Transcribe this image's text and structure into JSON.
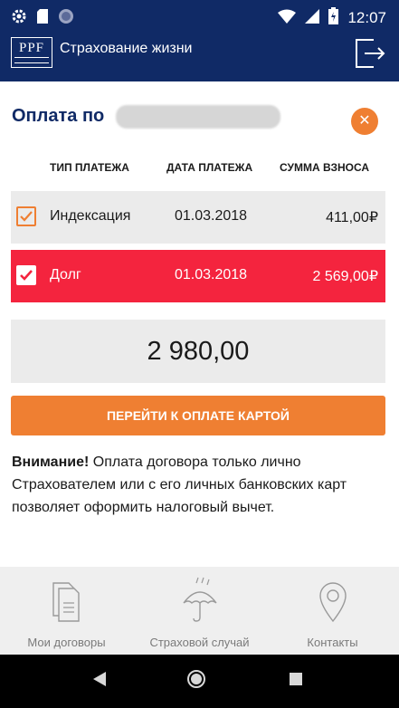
{
  "status_bar": {
    "time": "12:07",
    "icons_left": [
      "gear-icon",
      "sd-card-icon",
      "circle-icon"
    ],
    "icons_right": [
      "wifi-icon",
      "signal-icon",
      "battery-icon"
    ]
  },
  "app_bar": {
    "logo_text": "PPF",
    "title": "Страхование жизни",
    "logout_icon": "logout-icon"
  },
  "dialog": {
    "heading": "Оплата по",
    "close_icon": "close-icon",
    "columns": {
      "type": "ТИП ПЛАТЕЖА",
      "date": "ДАТА ПЛАТЕЖА",
      "sum": "СУММА ВЗНОСА"
    },
    "rows": [
      {
        "type": "Индексация",
        "date": "01.03.2018",
        "sum": "411,00₽",
        "checked": true
      },
      {
        "type": "Долг",
        "date": "01.03.2018",
        "sum": "2 569,00₽",
        "checked": true
      }
    ],
    "total": "2 980,00",
    "pay_button": "ПЕРЕЙТИ К ОПЛАТЕ КАРТОЙ",
    "note_bold": "Внимание!",
    "note_text": " Оплата договора только лично Страхователем или с его личных банковских карт позволяет оформить налоговый вычет."
  },
  "bottom_nav": [
    {
      "label": "Мои договоры",
      "icon": "documents-icon"
    },
    {
      "label": "Страховой случай",
      "icon": "umbrella-icon"
    },
    {
      "label": "Контакты",
      "icon": "location-pin-icon"
    }
  ],
  "colors": {
    "primary": "#102a66",
    "accent": "#ef7f32",
    "debt_row": "#f4243e",
    "row_bg": "#ebebeb"
  }
}
